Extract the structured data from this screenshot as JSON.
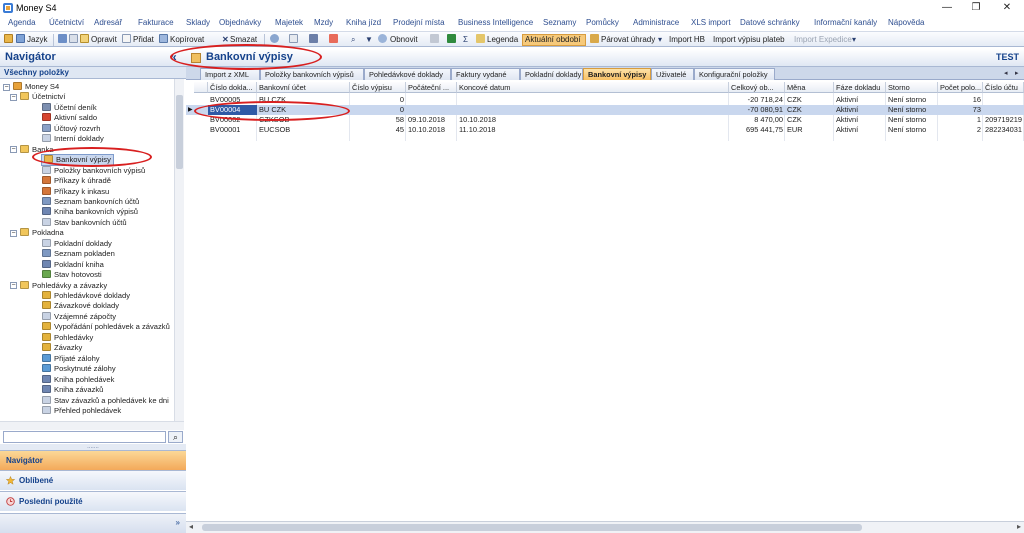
{
  "window": {
    "title": "Money S4",
    "minimize": "—",
    "restore": "❐",
    "close": "✕"
  },
  "menu": [
    "Agenda",
    "Účetnictví",
    "Adresář",
    "Fakturace",
    "Sklady",
    "Objednávky",
    "Majetek",
    "Mzdy",
    "Kniha jízd",
    "Prodejní místa",
    "Business Intelligence",
    "Seznamy",
    "Pomůcky",
    "Administrace",
    "XLS import",
    "Datové schránky",
    "Informační kanály",
    "Nápověda"
  ],
  "toolbar": {
    "jazyk": "Jazyk",
    "opravit": "Opravit",
    "pridat": "Přidat",
    "kopirovat": "Kopírovat",
    "smazat": "Smazat",
    "obnovit": "Obnovit",
    "legenda": "Legenda",
    "aktualni_obdobi": "Aktuální období",
    "parovat_uhrady": "Párovat úhrady",
    "import_hb": "Import HB",
    "import_vypisu": "Import výpisu plateb",
    "import_expedice": "Import Expedice"
  },
  "navigator": {
    "title": "Navigátor",
    "all_items": "Všechny položky",
    "tree": [
      {
        "label": "Money S4",
        "level": 0,
        "icon": "money-s4-icon",
        "expander": "−"
      },
      {
        "label": "Účetnictví",
        "level": 1,
        "icon": "folder-icon",
        "expander": "−"
      },
      {
        "label": "Účetní deník",
        "level": 2,
        "icon": "journal-icon"
      },
      {
        "label": "Aktivní saldo",
        "level": 2,
        "icon": "percent-icon"
      },
      {
        "label": "Účtový rozvrh",
        "level": 2,
        "icon": "chart-of-accounts-icon"
      },
      {
        "label": "Interní doklady",
        "level": 2,
        "icon": "document-icon"
      },
      {
        "label": "Banka",
        "level": 1,
        "icon": "folder-icon",
        "expander": "−"
      },
      {
        "label": "Bankovní výpisy",
        "level": 2,
        "icon": "bank-statement-icon",
        "selected": true
      },
      {
        "label": "Položky bankovních výpisů",
        "level": 2,
        "icon": "document-icon"
      },
      {
        "label": "Příkazy k úhradě",
        "level": 2,
        "icon": "payment-order-icon"
      },
      {
        "label": "Příkazy k inkasu",
        "level": 2,
        "icon": "payment-order-icon"
      },
      {
        "label": "Seznam bankovních účtů",
        "level": 2,
        "icon": "list-icon"
      },
      {
        "label": "Kniha bankovních výpisů",
        "level": 2,
        "icon": "book-icon"
      },
      {
        "label": "Stav bankovních účtů",
        "level": 2,
        "icon": "document-icon"
      },
      {
        "label": "Pokladna",
        "level": 1,
        "icon": "folder-icon",
        "expander": "−"
      },
      {
        "label": "Pokladní doklady",
        "level": 2,
        "icon": "document-icon"
      },
      {
        "label": "Seznam pokladen",
        "level": 2,
        "icon": "list-icon"
      },
      {
        "label": "Pokladní kniha",
        "level": 2,
        "icon": "book-icon"
      },
      {
        "label": "Stav hotovosti",
        "level": 2,
        "icon": "cash-icon"
      },
      {
        "label": "Pohledávky a závazky",
        "level": 1,
        "icon": "folder-icon",
        "expander": "−"
      },
      {
        "label": "Pohledávkové doklady",
        "level": 2,
        "icon": "coins-icon"
      },
      {
        "label": "Závazkové doklady",
        "level": 2,
        "icon": "coins-icon"
      },
      {
        "label": "Vzájemné zápočty",
        "level": 2,
        "icon": "document-icon"
      },
      {
        "label": "Vypořádání pohledávek a závazků",
        "level": 2,
        "icon": "coins-icon"
      },
      {
        "label": "Pohledávky",
        "level": 2,
        "icon": "coins-icon"
      },
      {
        "label": "Závazky",
        "level": 2,
        "icon": "coins-icon"
      },
      {
        "label": "Přijaté zálohy",
        "level": 2,
        "icon": "deposit-icon"
      },
      {
        "label": "Poskytnuté zálohy",
        "level": 2,
        "icon": "deposit-icon"
      },
      {
        "label": "Kniha pohledávek",
        "level": 2,
        "icon": "book-icon"
      },
      {
        "label": "Kniha závazků",
        "level": 2,
        "icon": "book-icon"
      },
      {
        "label": "Stav závazků a pohledávek ke dni",
        "level": 2,
        "icon": "document-icon"
      },
      {
        "label": "Přehled pohledávek",
        "level": 2,
        "icon": "document-icon"
      }
    ],
    "buttons": {
      "navigator": "Navigátor",
      "oblibene": "Oblíbené",
      "posledni": "Poslední použité"
    },
    "grip": "......."
  },
  "main": {
    "title": "Bankovní výpisy",
    "database": "TEST",
    "tabs": [
      "Import z XML",
      "Položky bankovních výpisů",
      "Pohledávkové doklady",
      "Faktury vydané",
      "Pokladní doklady",
      "Bankovní výpisy",
      "Uživatelé",
      "Konfigurační položky"
    ],
    "active_tab": 5,
    "columns": [
      "Číslo dokla...",
      "Bankovní účet",
      "Číslo výpisu",
      "Počáteční ...",
      "Koncové datum",
      "Celkový ob...",
      "Měna",
      "Fáze dokladu",
      "Storno",
      "Počet polo...",
      "Číslo účtu"
    ],
    "rows": [
      [
        "BV00005",
        "BU CZK",
        "0",
        "",
        "",
        "-20 718,24",
        "CZK",
        "Aktivní",
        "Není storno",
        "16",
        ""
      ],
      [
        "BV00004",
        "BU CZK",
        "0",
        "",
        "",
        "-70 080,91",
        "CZK",
        "Aktivní",
        "Není storno",
        "73",
        ""
      ],
      [
        "BV00002",
        "CZKSOB",
        "58",
        "09.10.2018",
        "10.10.2018",
        "8 470,00",
        "CZK",
        "Aktivní",
        "Není storno",
        "1",
        "209719219"
      ],
      [
        "BV00001",
        "EUCSOB",
        "45",
        "10.10.2018",
        "11.10.2018",
        "695 441,75",
        "EUR",
        "Aktivní",
        "Není storno",
        "2",
        "282234031"
      ]
    ],
    "selected_row": 1
  },
  "colors": {
    "accent": "#15428b",
    "active_tab": "#f7c065",
    "annotation": "#d81f1f"
  }
}
